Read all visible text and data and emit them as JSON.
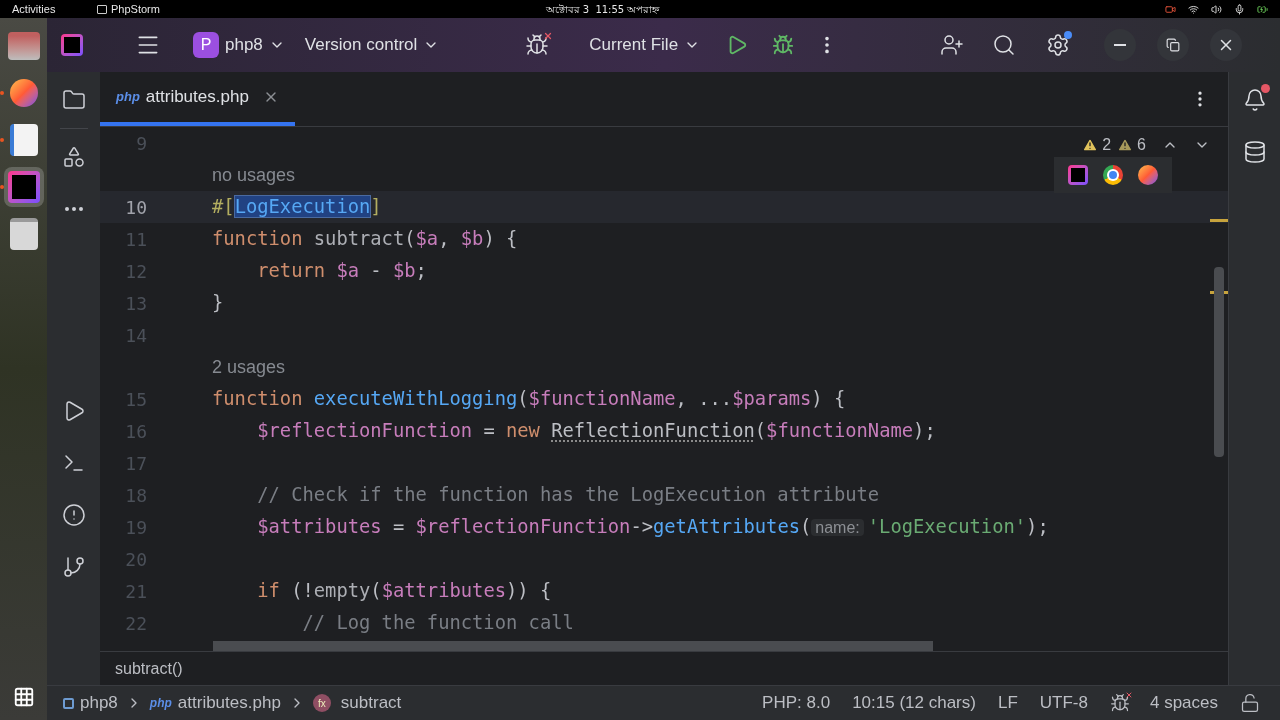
{
  "system_bar": {
    "activities": "Activities",
    "app_name": "PhpStorm",
    "clock": "অক্টোবর 3  11:55 অপরাহ্ন"
  },
  "dock": [
    {
      "kind": "files",
      "running": false,
      "selected": false
    },
    {
      "kind": "firefox",
      "running": true,
      "selected": false
    },
    {
      "kind": "editor",
      "running": true,
      "selected": false
    },
    {
      "kind": "phpstorm",
      "running": true,
      "selected": true
    },
    {
      "kind": "trash",
      "running": false,
      "selected": false
    }
  ],
  "toolbar": {
    "project_badge": "P",
    "project": "php8",
    "vcs": "Version control",
    "run_config": "Current File",
    "settings_update": true
  },
  "notifications_unread": true,
  "tabs": [
    {
      "label": "attributes.php",
      "type_label": "php",
      "selected": true
    }
  ],
  "inspections": {
    "warnings": "2",
    "weak_warnings": "6"
  },
  "browsers": [
    {
      "kind": "phpstorm"
    },
    {
      "kind": "chrome"
    },
    {
      "kind": "firefox"
    }
  ],
  "lines": [
    {
      "kind": "code",
      "number": "9",
      "current": false
    },
    {
      "kind": "hint",
      "text": "no usages",
      "current": false
    },
    {
      "kind": "code",
      "number": "10",
      "current": true,
      "tokens": [
        {
          "kind": "attr",
          "text": "#["
        },
        {
          "kind": "selected",
          "text": "LogExecution"
        },
        {
          "kind": "attr",
          "text": "]"
        }
      ]
    },
    {
      "kind": "code",
      "number": "11",
      "current": false,
      "tokens": [
        {
          "kind": "kw",
          "text": "function "
        },
        {
          "kind": "fn_dim",
          "text": "subtract"
        },
        {
          "kind": "plain",
          "text": "("
        },
        {
          "kind": "var",
          "text": "$a"
        },
        {
          "kind": "plain",
          "text": ", "
        },
        {
          "kind": "var",
          "text": "$b"
        },
        {
          "kind": "plain",
          "text": ") {"
        }
      ]
    },
    {
      "kind": "code",
      "number": "12",
      "current": false,
      "tokens": [
        {
          "kind": "kw",
          "text": "    return "
        },
        {
          "kind": "var",
          "text": "$a"
        },
        {
          "kind": "plain",
          "text": " - "
        },
        {
          "kind": "var",
          "text": "$b"
        },
        {
          "kind": "plain",
          "text": ";"
        }
      ]
    },
    {
      "kind": "code",
      "number": "13",
      "current": false,
      "tokens": [
        {
          "kind": "plain",
          "text": "}"
        }
      ]
    },
    {
      "kind": "code",
      "number": "14",
      "current": false
    },
    {
      "kind": "hint",
      "text": "2 usages",
      "current": false
    },
    {
      "kind": "code",
      "number": "15",
      "current": false,
      "tokens": [
        {
          "kind": "kw",
          "text": "function "
        },
        {
          "kind": "fn",
          "text": "executeWithLogging"
        },
        {
          "kind": "plain",
          "text": "("
        },
        {
          "kind": "var",
          "text": "$functionName"
        },
        {
          "kind": "plain",
          "text": ", ..."
        },
        {
          "kind": "var",
          "text": "$params"
        },
        {
          "kind": "plain",
          "text": ") {"
        }
      ]
    },
    {
      "kind": "code",
      "number": "16",
      "current": false,
      "tokens": [
        {
          "kind": "var",
          "text": "    $reflectionFunction"
        },
        {
          "kind": "plain",
          "text": " = "
        },
        {
          "kind": "kw",
          "text": "new "
        },
        {
          "kind": "cls",
          "text": "ReflectionFunction"
        },
        {
          "kind": "plain",
          "text": "("
        },
        {
          "kind": "var",
          "text": "$functionName"
        },
        {
          "kind": "plain",
          "text": ");"
        }
      ]
    },
    {
      "kind": "code",
      "number": "17",
      "current": false
    },
    {
      "kind": "code",
      "number": "18",
      "current": false,
      "tokens": [
        {
          "kind": "comment",
          "text": "    // Check if the function has the LogExecution attribute"
        }
      ]
    },
    {
      "kind": "code",
      "number": "19",
      "current": false,
      "tokens": [
        {
          "kind": "var",
          "text": "    $attributes"
        },
        {
          "kind": "plain",
          "text": " = "
        },
        {
          "kind": "var",
          "text": "$reflectionFunction"
        },
        {
          "kind": "plain",
          "text": "->"
        },
        {
          "kind": "fn",
          "text": "getAttributes"
        },
        {
          "kind": "plain",
          "text": "("
        },
        {
          "kind": "inlay",
          "text": "name:"
        },
        {
          "kind": "str",
          "text": "'LogExecution'"
        },
        {
          "kind": "plain",
          "text": ");"
        }
      ]
    },
    {
      "kind": "code",
      "number": "20",
      "current": false
    },
    {
      "kind": "code",
      "number": "21",
      "current": false,
      "tokens": [
        {
          "kind": "kw",
          "text": "    if "
        },
        {
          "kind": "plain",
          "text": "(!"
        },
        {
          "kind": "fn_dim",
          "text": "empty"
        },
        {
          "kind": "plain",
          "text": "("
        },
        {
          "kind": "var",
          "text": "$attributes"
        },
        {
          "kind": "plain",
          "text": ")) {"
        }
      ]
    },
    {
      "kind": "code",
      "number": "22",
      "current": false,
      "tokens": [
        {
          "kind": "comment",
          "text": "        // Log the function call"
        }
      ]
    }
  ],
  "breadcrumb": "subtract()",
  "status": {
    "path": [
      {
        "kind": "project",
        "label": "php8"
      },
      {
        "kind": "file",
        "label": "attributes.php",
        "badge": "php"
      },
      {
        "kind": "function",
        "label": "subtract",
        "badge": "fx"
      }
    ],
    "items": [
      "PHP: 8.0",
      "10:15 (12 chars)",
      "LF",
      "UTF-8",
      "4 spaces"
    ]
  }
}
